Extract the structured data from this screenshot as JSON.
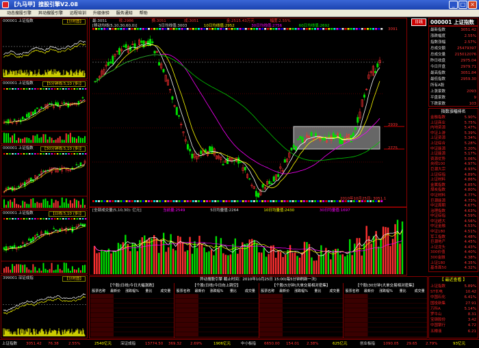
{
  "window": {
    "title": "【九马甲】搜股引擎V2.08",
    "min": "_",
    "max": "□",
    "close": "×"
  },
  "menu": [
    "动态搜股引擎",
    "异动搜股引擎",
    "远程培训",
    "升级体验",
    "服务通知",
    "帮助"
  ],
  "left_panels": [
    {
      "code": "000001",
      "name": "上证指数",
      "tag": "【分时图】"
    },
    {
      "code": "000001",
      "name": "上证指数",
      "tag": "【5分钟线:5,10 (多)】"
    },
    {
      "code": "000001",
      "name": "上证指数",
      "tag": "【30分钟线:5,10 (多)】"
    },
    {
      "code": "000001",
      "name": "上证指数",
      "tag": "【日线:5,10 (多)】"
    },
    {
      "code": "399001",
      "name": "深证成指",
      "tag": "【分时图】"
    }
  ],
  "main_chart": {
    "info_top": [
      "最:3051",
      "收:2986",
      "换:3051",
      "成:3051",
      "金:2515.43万元",
      "幅度:2.55%"
    ],
    "ma_line": {
      "label": "[移动均线(5,10,30,60,0)]",
      "ma5": "5日均线值:3003",
      "ma10": "10日均线值:2952",
      "ma30": "30日均线值:2756",
      "ma60": "60日均线值:2692"
    },
    "price_hi": "3091",
    "price_mid": "2858",
    "price_lo": "2625",
    "box_top": "2939",
    "box_bottom": "2775",
    "date_label": "2010年10月25日: 3051.1",
    "vol_line": {
      "label": "[全部成交量(5,10,30): 亿元]",
      "cur": "当前量:2549",
      "ma5": "5日均量值:2264",
      "ma10": "10日均量值:2430",
      "ma30": "30日均量值:1697"
    },
    "badge": "日线"
  },
  "right_header": {
    "code": "000001",
    "name": "上证指数"
  },
  "right_stats": [
    {
      "k": "最新指数",
      "v": "3051.42"
    },
    {
      "k": "涨跌幅度",
      "v": "2.55%"
    },
    {
      "k": "指数涨幅",
      "v": "2.57%"
    },
    {
      "k": "总成交额",
      "v": "25479397"
    },
    {
      "k": "总成交量",
      "v": "215012076"
    },
    {
      "k": "昨日收盘",
      "v": "2975.04"
    },
    {
      "k": "今日开盘",
      "v": "2979.71"
    },
    {
      "k": "最高指数",
      "v": "3051.84"
    },
    {
      "k": "最低指数",
      "v": "2959.30"
    },
    {
      "k": "所有A股",
      "v": ""
    },
    {
      "k": "上涨家数",
      "v": "2093"
    },
    {
      "k": "平盘家数",
      "v": "9"
    },
    {
      "k": "下跌家数",
      "v": "103"
    }
  ],
  "rank": {
    "title": "指数涨幅排名",
    "items": [
      {
        "n": "金融指数",
        "v": "5.90%"
      },
      {
        "n": "上证商业",
        "v": "5.75%"
      },
      {
        "n": "内地资源",
        "v": "5.47%"
      },
      {
        "n": "中证上游",
        "v": "5.39%"
      },
      {
        "n": "上证资源",
        "v": "5.34%"
      },
      {
        "n": "上证综合",
        "v": "5.28%"
      },
      {
        "n": "中证能源",
        "v": "5.20%"
      },
      {
        "n": "上证能源",
        "v": "5.17%"
      },
      {
        "n": "资源优势",
        "v": "5.06%"
      },
      {
        "n": "央视100",
        "v": "4.97%"
      },
      {
        "n": "巨潮大宗",
        "v": "4.93%"
      },
      {
        "n": "上证综指",
        "v": "4.89%"
      },
      {
        "n": "上证材料",
        "v": "4.86%"
      },
      {
        "n": "金属指数",
        "v": "4.85%"
      },
      {
        "n": "煤炭指数",
        "v": "4.80%"
      },
      {
        "n": "中证材料",
        "v": "4.77%"
      },
      {
        "n": "巨潮能源",
        "v": "4.73%"
      },
      {
        "n": "中证周期",
        "v": "4.67%"
      },
      {
        "n": "治理指数",
        "v": "4.63%"
      },
      {
        "n": "中证综指",
        "v": "4.59%"
      },
      {
        "n": "中证超大",
        "v": "4.56%"
      },
      {
        "n": "中证金融",
        "v": "4.53%"
      },
      {
        "n": "中证180",
        "v": "4.51%"
      },
      {
        "n": "军工指数",
        "v": "4.48%"
      },
      {
        "n": "巨潮地产",
        "v": "4.45%"
      },
      {
        "n": "上证龙头",
        "v": "4.43%"
      },
      {
        "n": "300价值",
        "v": "4.40%"
      },
      {
        "n": "300金融",
        "v": "4.38%"
      },
      {
        "n": "上证180",
        "v": "4.35%"
      },
      {
        "n": "基本面50",
        "v": "4.32%"
      }
    ]
  },
  "recent": {
    "title": "【 最近查看 】",
    "items": [
      {
        "n": "上证指数",
        "v": "5.89%"
      },
      {
        "n": "ST长电",
        "v": "10.42"
      },
      {
        "n": "中国石化",
        "v": "6.41%"
      },
      {
        "n": "国投新集",
        "v": "27.91"
      },
      {
        "n": "万科A",
        "v": "5.14%"
      },
      {
        "n": "罗牛山",
        "v": "8.31"
      },
      {
        "n": "宝钢股份",
        "v": "3.42"
      },
      {
        "n": "中国银行",
        "v": "4.72"
      },
      {
        "n": "五粮液",
        "v": "6.21"
      }
    ]
  },
  "bottom": {
    "header": "异动搜股引擎  截止时间：2010年10月25日 15:00(每5分钟刷新一次)",
    "tables": [
      {
        "title": "【个股(日线)今日大幅涨跌】",
        "cols": [
          "股票名称",
          "最新价",
          "涨跌幅%",
          "量比",
          "成交量"
        ]
      },
      {
        "title": "【个股(日线)今日向上跳空】",
        "cols": [
          "股票名称",
          "最新价",
          "涨跌幅%",
          "量比",
          "成交量"
        ]
      },
      {
        "title": "【个股(5分钟)大单交易相对密集】",
        "cols": [
          "股票名称",
          "最新价",
          "涨跌幅%",
          "量比",
          "成交量"
        ]
      },
      {
        "title": "【个股(30分钟)大单交易相对密集】",
        "cols": [
          "股票名称",
          "最新价",
          "涨跌幅%",
          "量比",
          "成交量"
        ]
      }
    ]
  },
  "status": {
    "sh_name": "上证指数",
    "sh_val": "3051.42",
    "sh_chg": "76.38",
    "sh_pct": "2.55%",
    "sh_amt": "2540亿元",
    "sz_name": "深证成指",
    "sz_val": "13774.50",
    "sz_chg": "369.32",
    "sz_pct": "2.69%",
    "sz_amt": "1906亿元",
    "zx_name": "中小板指",
    "zx_val": "6650.00",
    "zx_chg": "154.01",
    "zx_pct": "2.38%",
    "zx_amt": "625亿元",
    "cy_name": "创业板指",
    "cy_val": "1090.05",
    "cy_chg": "29.65",
    "cy_pct": "2.79%",
    "cy_amt": "93亿元"
  },
  "colors": {
    "up": "#ff3030",
    "down": "#00e000",
    "frame": "#880000",
    "accent": "#ffff00"
  }
}
